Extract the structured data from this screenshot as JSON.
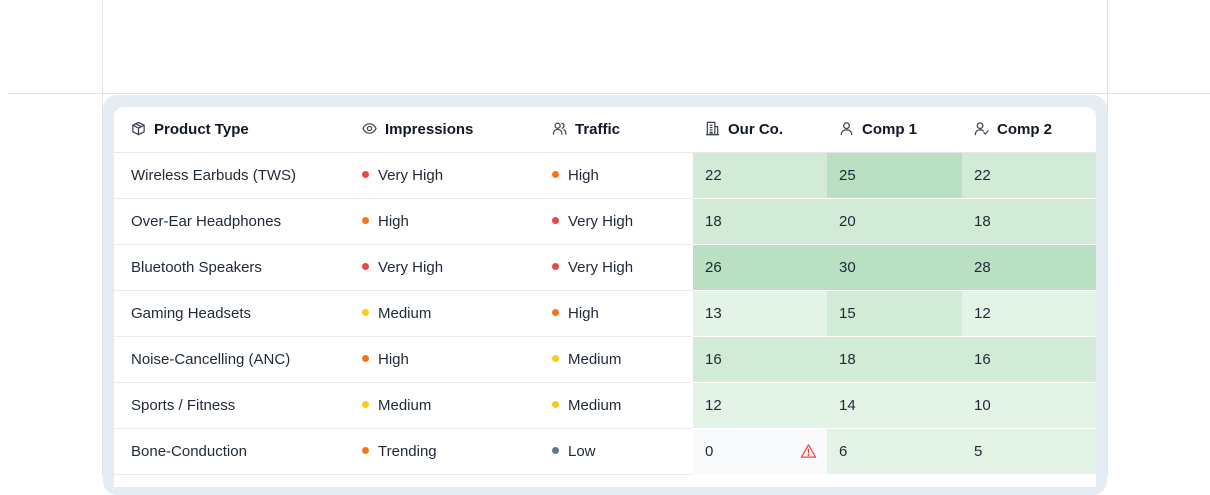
{
  "columns": [
    {
      "label": "Product Type",
      "icon": "package-icon"
    },
    {
      "label": "Impressions",
      "icon": "eye-icon"
    },
    {
      "label": "Traffic",
      "icon": "users-icon"
    },
    {
      "label": "Our Co.",
      "icon": "building-icon"
    },
    {
      "label": "Comp 1",
      "icon": "user-icon"
    },
    {
      "label": "Comp 2",
      "icon": "user-check-icon"
    }
  ],
  "level_colors": {
    "Very High": "#ef4444",
    "High": "#f97316",
    "Medium": "#facc15",
    "Trending": "#f97316",
    "Low": "#64748b"
  },
  "heat_colors": {
    "light": "#e3f3e6",
    "mid": "#d1ebd7",
    "strong": "#b9e0c3",
    "empty": "#f8fafc"
  },
  "rows": [
    {
      "product": "Wireless Earbuds (TWS)",
      "impressions": "Very High",
      "traffic": "High",
      "our_co": "22",
      "comp1": "25",
      "comp2": "22",
      "shade": [
        "mid",
        "strong",
        "mid"
      ]
    },
    {
      "product": "Over-Ear Headphones",
      "impressions": "High",
      "traffic": "Very High",
      "our_co": "18",
      "comp1": "20",
      "comp2": "18",
      "shade": [
        "mid",
        "mid",
        "mid"
      ]
    },
    {
      "product": "Bluetooth Speakers",
      "impressions": "Very High",
      "traffic": "Very High",
      "our_co": "26",
      "comp1": "30",
      "comp2": "28",
      "shade": [
        "strong",
        "strong",
        "strong"
      ]
    },
    {
      "product": "Gaming Headsets",
      "impressions": "Medium",
      "traffic": "High",
      "our_co": "13",
      "comp1": "15",
      "comp2": "12",
      "shade": [
        "light",
        "mid",
        "light"
      ]
    },
    {
      "product": "Noise-Cancelling (ANC)",
      "impressions": "High",
      "traffic": "Medium",
      "our_co": "16",
      "comp1": "18",
      "comp2": "16",
      "shade": [
        "mid",
        "mid",
        "mid"
      ]
    },
    {
      "product": "Sports / Fitness",
      "impressions": "Medium",
      "traffic": "Medium",
      "our_co": "12",
      "comp1": "14",
      "comp2": "10",
      "shade": [
        "light",
        "light",
        "light"
      ]
    },
    {
      "product": "Bone-Conduction",
      "impressions": "Trending",
      "traffic": "Low",
      "our_co": "0",
      "comp1": "6",
      "comp2": "5",
      "shade": [
        "empty",
        "light",
        "light"
      ],
      "warning": true
    }
  ]
}
